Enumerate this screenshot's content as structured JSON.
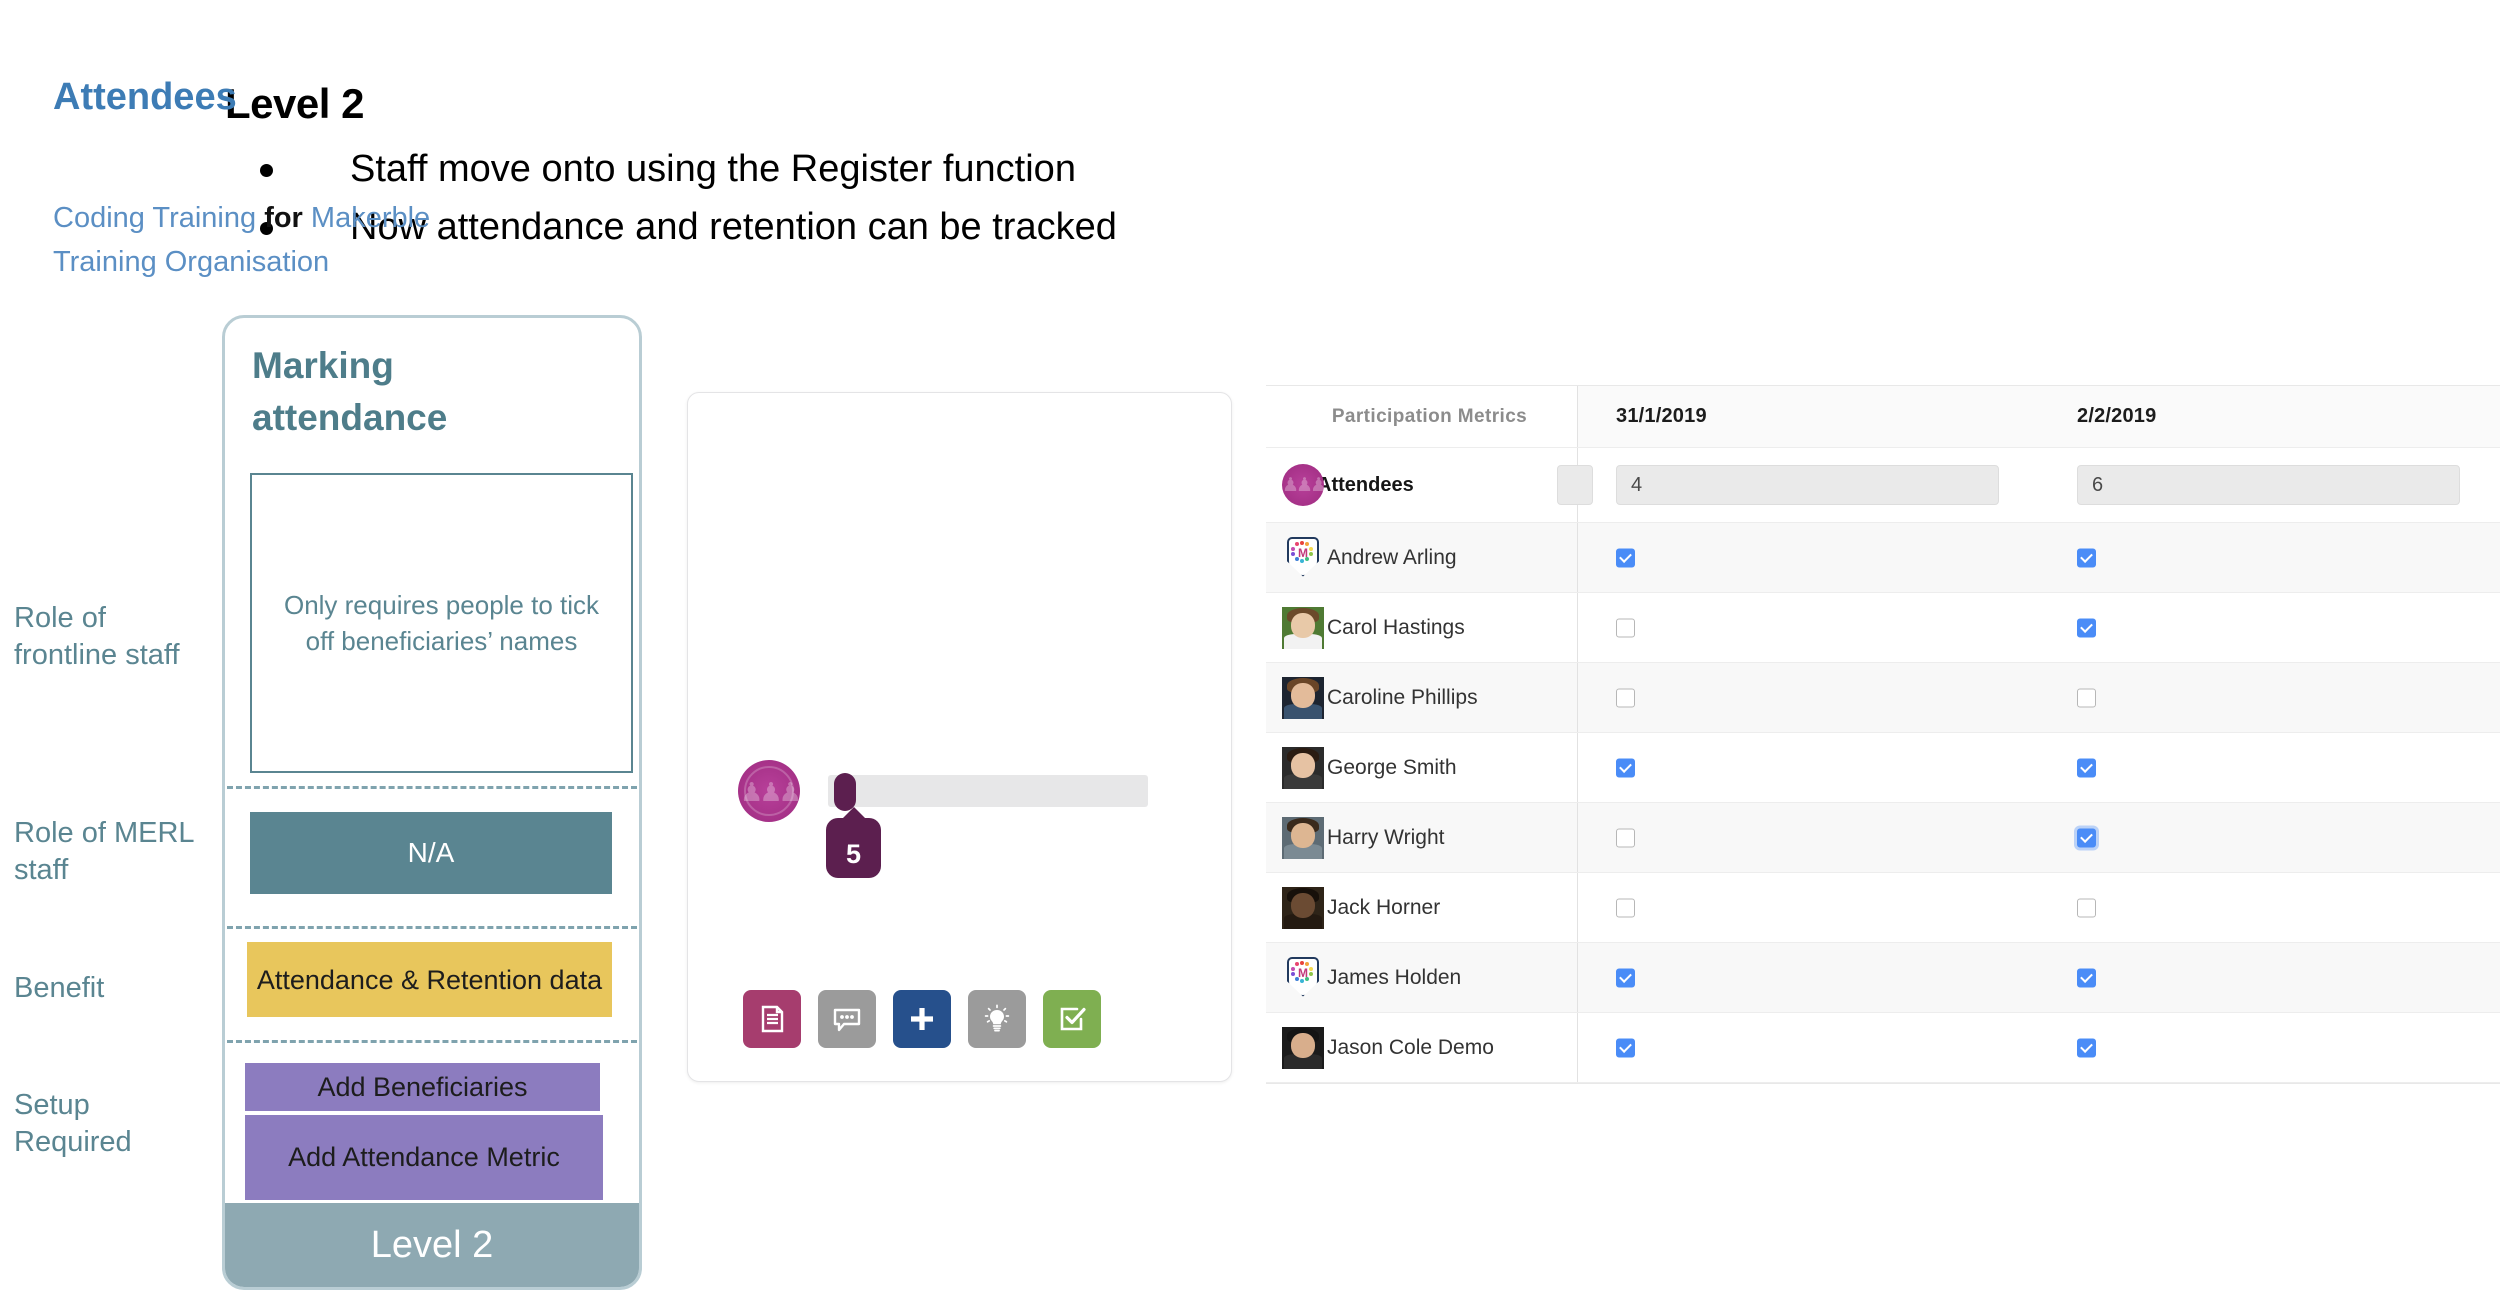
{
  "slide": {
    "title": "Level 2",
    "bullets": [
      "Staff move onto using the Register function",
      "Now attendance and retention can be tracked"
    ]
  },
  "row_labels": {
    "frontline": "Role of frontline staff",
    "merl": "Role of MERL staff",
    "benefit": "Benefit",
    "setup": "Setup Required"
  },
  "level_card": {
    "title": "Marking attendance",
    "description": "Only requires people to tick off beneficiaries’ names",
    "merl_role": "N/A",
    "benefit": "Attendance & Retention data",
    "setup_items": [
      "Add Beneficiaries",
      "Add Attendance Metric"
    ],
    "footer": "Level 2",
    "colors": {
      "border": "#B9CDD4",
      "title_text": "#4E7D8A",
      "na_block": "#5A8591",
      "benefit_block": "#E8C65C",
      "setup_block": "#8C7CBF",
      "footer": "#8EA9B2"
    }
  },
  "attendees_card": {
    "title": "Attendees",
    "subtitle_part1": "Coding Training ",
    "subtitle_for": "for",
    "subtitle_part2": " Makerble Training Organisation",
    "slider_value": "5",
    "accent_color": "#3D7CB5",
    "slider_color": "#5C1F4F",
    "coin_color": "#A8338A",
    "buttons": [
      {
        "name": "notes-icon",
        "label": "Notes",
        "color": "#A63D6E"
      },
      {
        "name": "comment-icon",
        "label": "Comment",
        "color": "#9B9B9B"
      },
      {
        "name": "plus-icon",
        "label": "Add",
        "color": "#26508C"
      },
      {
        "name": "lightbulb-icon",
        "label": "Idea",
        "color": "#9B9B9B"
      },
      {
        "name": "checkbox-icon",
        "label": "Tasks",
        "color": "#7FAF51"
      }
    ]
  },
  "table": {
    "header": {
      "metrics_label": "Participation Metrics",
      "dates": [
        "31/1/2019",
        "2/2/2019"
      ]
    },
    "metric_row": {
      "name": "Attendees",
      "values": [
        "4",
        "6"
      ],
      "truncated_value": ""
    },
    "people": [
      {
        "name": "Andrew Arling",
        "avatar": "shield",
        "checks": [
          true,
          true
        ]
      },
      {
        "name": "Carol Hastings",
        "avatar": "photo-field",
        "checks": [
          false,
          true
        ]
      },
      {
        "name": "Caroline Phillips",
        "avatar": "photo-woman",
        "checks": [
          false,
          false
        ]
      },
      {
        "name": "George Smith",
        "avatar": "photo-man1",
        "checks": [
          true,
          true
        ]
      },
      {
        "name": "Harry Wright",
        "avatar": "photo-man2",
        "checks": [
          false,
          true
        ],
        "focused": [
          false,
          true
        ]
      },
      {
        "name": "Jack Horner",
        "avatar": "photo-man3",
        "checks": [
          false,
          false
        ]
      },
      {
        "name": "James Holden",
        "avatar": "shield",
        "checks": [
          true,
          true
        ]
      },
      {
        "name": "Jason Cole Demo",
        "avatar": "photo-man4",
        "checks": [
          true,
          true
        ]
      }
    ],
    "colors": {
      "checkbox_checked": "#4A8CF7",
      "stripe": "#F8F8F8",
      "header_bg": "#FAFAFA"
    }
  }
}
